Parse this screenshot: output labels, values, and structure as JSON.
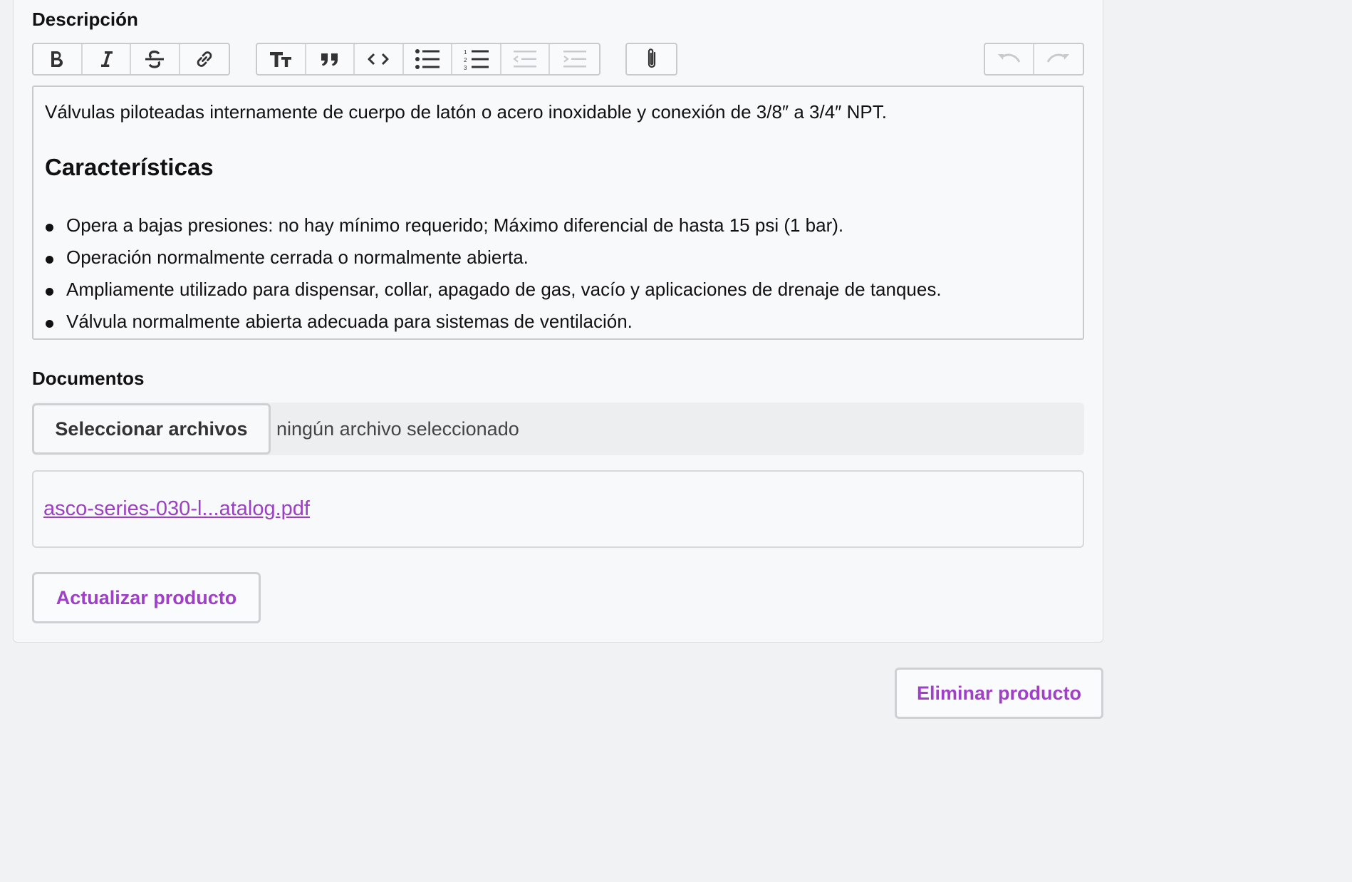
{
  "description": {
    "label": "Descripción",
    "toolbar": {
      "bold": "bold-icon",
      "italic": "italic-icon",
      "strike": "strikethrough-icon",
      "link": "link-icon",
      "heading": "heading-icon",
      "quote": "quote-icon",
      "code": "code-icon",
      "bullets": "bullet-list-icon",
      "numbers": "numbered-list-icon",
      "outdent": "decrease-indent-icon",
      "indent": "increase-indent-icon",
      "attach": "paperclip-icon",
      "undo": "undo-icon",
      "redo": "redo-icon"
    },
    "content": {
      "intro": "Válvulas piloteadas internamente de cuerpo de latón o acero inoxidable y conexión de 3/8″ a 3/4″ NPT.",
      "heading": "Características",
      "bullets": [
        "Opera a bajas presiones: no hay mínimo requerido; Máximo diferencial de hasta 15 psi (1 bar).",
        "Operación normalmente cerrada o normalmente abierta.",
        "Ampliamente utilizado para dispensar, collar, apagado de gas, vacío y aplicaciones de drenaje de tanques.",
        "Válvula normalmente abierta adecuada para sistemas de ventilación."
      ]
    }
  },
  "documents": {
    "label": "Documentos",
    "choose_button": "Seleccionar archivos",
    "no_file_text": "ningún archivo seleccionado",
    "attachment_link": "asco-series-030-l...atalog.pdf"
  },
  "actions": {
    "update": "Actualizar producto",
    "delete": "Eliminar producto"
  },
  "colors": {
    "accent": "#a03fc8",
    "link": "#9b3fc3"
  }
}
